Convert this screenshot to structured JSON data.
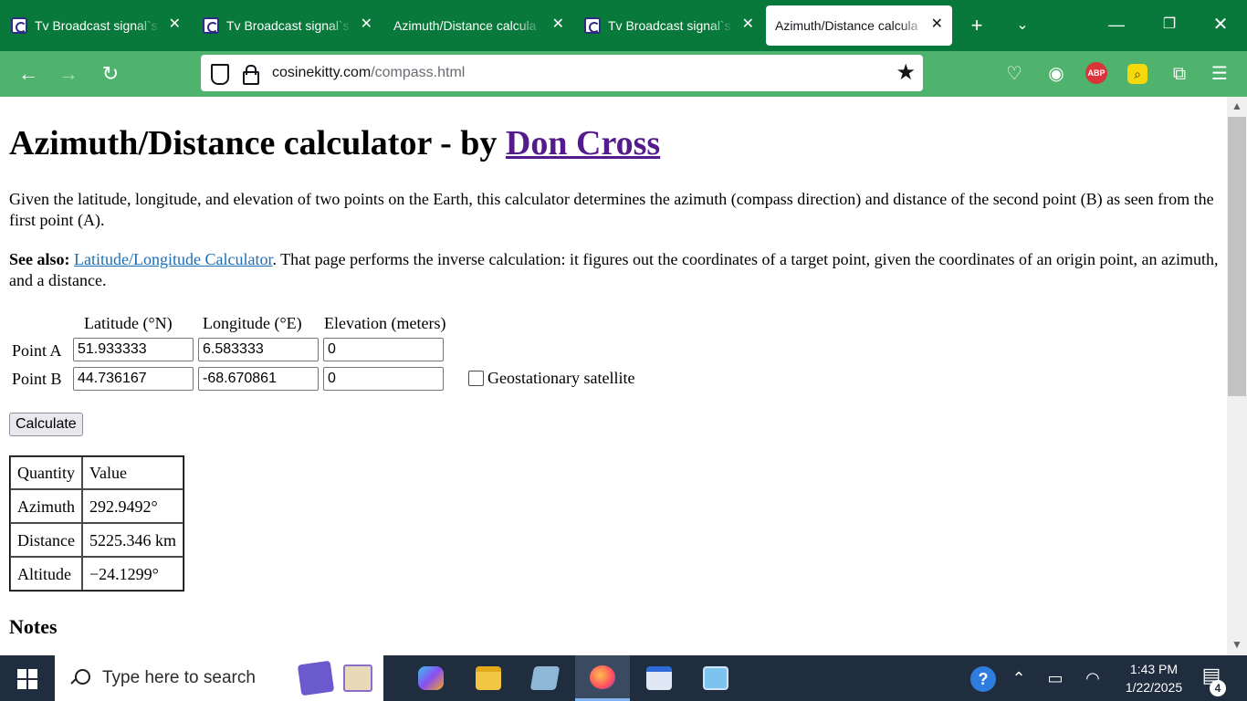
{
  "browser": {
    "tabs": [
      {
        "title": "Tv Broadcast signal`s",
        "active": false
      },
      {
        "title": "Tv Broadcast signal`s",
        "active": false
      },
      {
        "title": "Azimuth/Distance calcula",
        "active": false
      },
      {
        "title": "Tv Broadcast signal`s",
        "active": false
      },
      {
        "title": "Azimuth/Distance calcula",
        "active": true
      }
    ],
    "url_domain": "cosinekitty.com",
    "url_path": "/compass.html",
    "colors": {
      "tabstrip": "#08793a",
      "navbar": "#4fb26d"
    }
  },
  "page": {
    "title_prefix": "Azimuth/Distance calculator - by ",
    "author_link": "Don Cross",
    "intro": "Given the latitude, longitude, and elevation of two points on the Earth, this calculator determines the azimuth (compass direction) and distance of the second point (B) as seen from the first point (A).",
    "see_also_label": "See also:",
    "see_also_link": "Latitude/Longitude Calculator",
    "see_also_text": ". That page performs the inverse calculation: it figures out the coordinates of a target point, given the coordinates of an origin point, an azimuth, and a distance.",
    "form": {
      "headers": [
        "Latitude (°N)",
        "Longitude (°E)",
        "Elevation (meters)"
      ],
      "point_a_label": "Point A",
      "point_b_label": "Point B",
      "point_a": {
        "lat": "51.933333",
        "lon": "6.583333",
        "elev": "0"
      },
      "point_b": {
        "lat": "44.736167",
        "lon": "-68.670861",
        "elev": "0"
      },
      "geostationary_label": "Geostationary satellite",
      "geostationary_checked": false,
      "calculate_label": "Calculate"
    },
    "results": {
      "header": [
        "Quantity",
        "Value"
      ],
      "rows": [
        [
          "Azimuth",
          "292.9492°"
        ],
        [
          "Distance",
          "5225.346 km"
        ],
        [
          "Altitude",
          "−24.1299°"
        ]
      ]
    },
    "notes_heading": "Notes"
  },
  "taskbar": {
    "search_placeholder": "Type here to search",
    "time": "1:43 PM",
    "date": "1/22/2025",
    "notification_count": "4"
  }
}
